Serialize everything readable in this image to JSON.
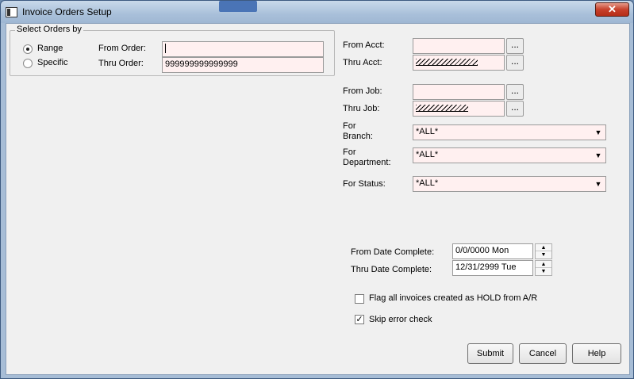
{
  "window": {
    "title": "Invoice Orders Setup",
    "close_label": "✕"
  },
  "select_group": {
    "legend": "Select Orders by",
    "options": [
      {
        "label": "Range",
        "checked": true
      },
      {
        "label": "Specific",
        "checked": false
      }
    ],
    "from_order_label": "From Order:",
    "from_order_value": "",
    "thru_order_label": "Thru Order:",
    "thru_order_value": "999999999999999"
  },
  "acct": {
    "from_label": "From Acct:",
    "from_value": "",
    "thru_label": "Thru Acct:",
    "browse_label": "..."
  },
  "job": {
    "from_label": "From Job:",
    "from_value": "",
    "thru_label": "Thru Job:"
  },
  "filters": {
    "branch_label_1": "For",
    "branch_label_2": "Branch:",
    "branch_value": "*ALL*",
    "department_label_1": "For",
    "department_label_2": "Department:",
    "department_value": "*ALL*",
    "status_label": "For Status:",
    "status_value": "*ALL*"
  },
  "dates": {
    "from_label": "From Date Complete:",
    "from_value": "0/0/0000 Mon",
    "thru_label": "Thru Date Complete:",
    "thru_value": "12/31/2999 Tue"
  },
  "options": {
    "hold_label": "Flag all invoices created as HOLD from A/R",
    "hold_checked": false,
    "skip_label": "Skip error check",
    "skip_checked": true
  },
  "buttons": {
    "submit": "Submit",
    "cancel": "Cancel",
    "help": "Help"
  },
  "icons": {
    "up": "▲",
    "down": "▼",
    "check": "✓"
  }
}
